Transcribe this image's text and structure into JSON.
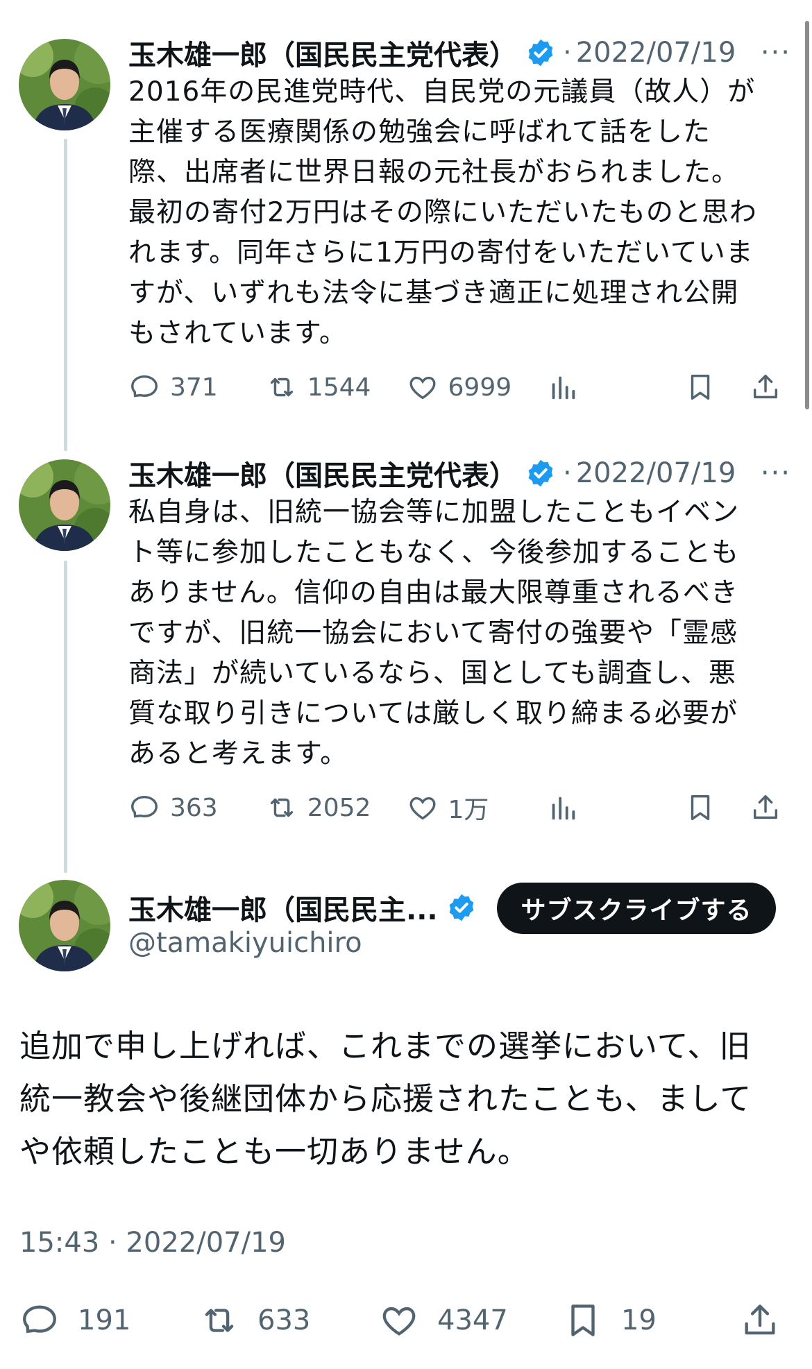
{
  "tweets": [
    {
      "name": "玉木雄一郎（国民民主党代表）",
      "date": "2022/07/19",
      "text": "2016年の民進党時代、自民党の元議員（故人）が\n主催する医療関係の勉強会に呼ばれて話をした\n際、出席者に世界日報の元社長がおられました。\n最初の寄付2万円はその際にいただいたものと思わ\nれます。同年さらに1万円の寄付をいただいていま\nすが、いずれも法令に基づき適正に処理され公開\nもされています。",
      "replies": "371",
      "retweets": "1544",
      "likes": "6999"
    },
    {
      "name": "玉木雄一郎（国民民主党代表）",
      "date": "2022/07/19",
      "text": "私自身は、旧統一協会等に加盟したこともイベン\nト等に参加したこともなく、今後参加することも\nありません。信仰の自由は最大限尊重されるべき\nですが、旧統一協会において寄付の強要や「霊感\n商法」が続いているなら、国としても調査し、悪\n質な取り引きについては厳しく取り締まる必要が\nあると考えます。",
      "replies": "363",
      "retweets": "2052",
      "likes": "1万"
    }
  ],
  "main_tweet": {
    "name": "玉木雄一郎（国民民主...",
    "handle": "@tamakiyuichiro",
    "subscribe_label": "サブスクライブする",
    "text": "追加で申し上げれば、これまでの選挙において、旧\n統一教会や後継団体から応援されたことも、まして\nや依頼したことも一切ありません。",
    "timestamp": "15:43 · 2022/07/19",
    "replies": "191",
    "retweets": "633",
    "likes": "4347",
    "bookmarks": "19"
  },
  "separator": "·",
  "more_label": "···",
  "colors": {
    "verified": "#1d9bf0",
    "muted": "#536471",
    "button": "#0f1419"
  },
  "icons": [
    "reply-icon",
    "retweet-icon",
    "like-icon",
    "views-icon",
    "bookmark-icon",
    "share-icon",
    "verified-icon",
    "more-icon"
  ]
}
